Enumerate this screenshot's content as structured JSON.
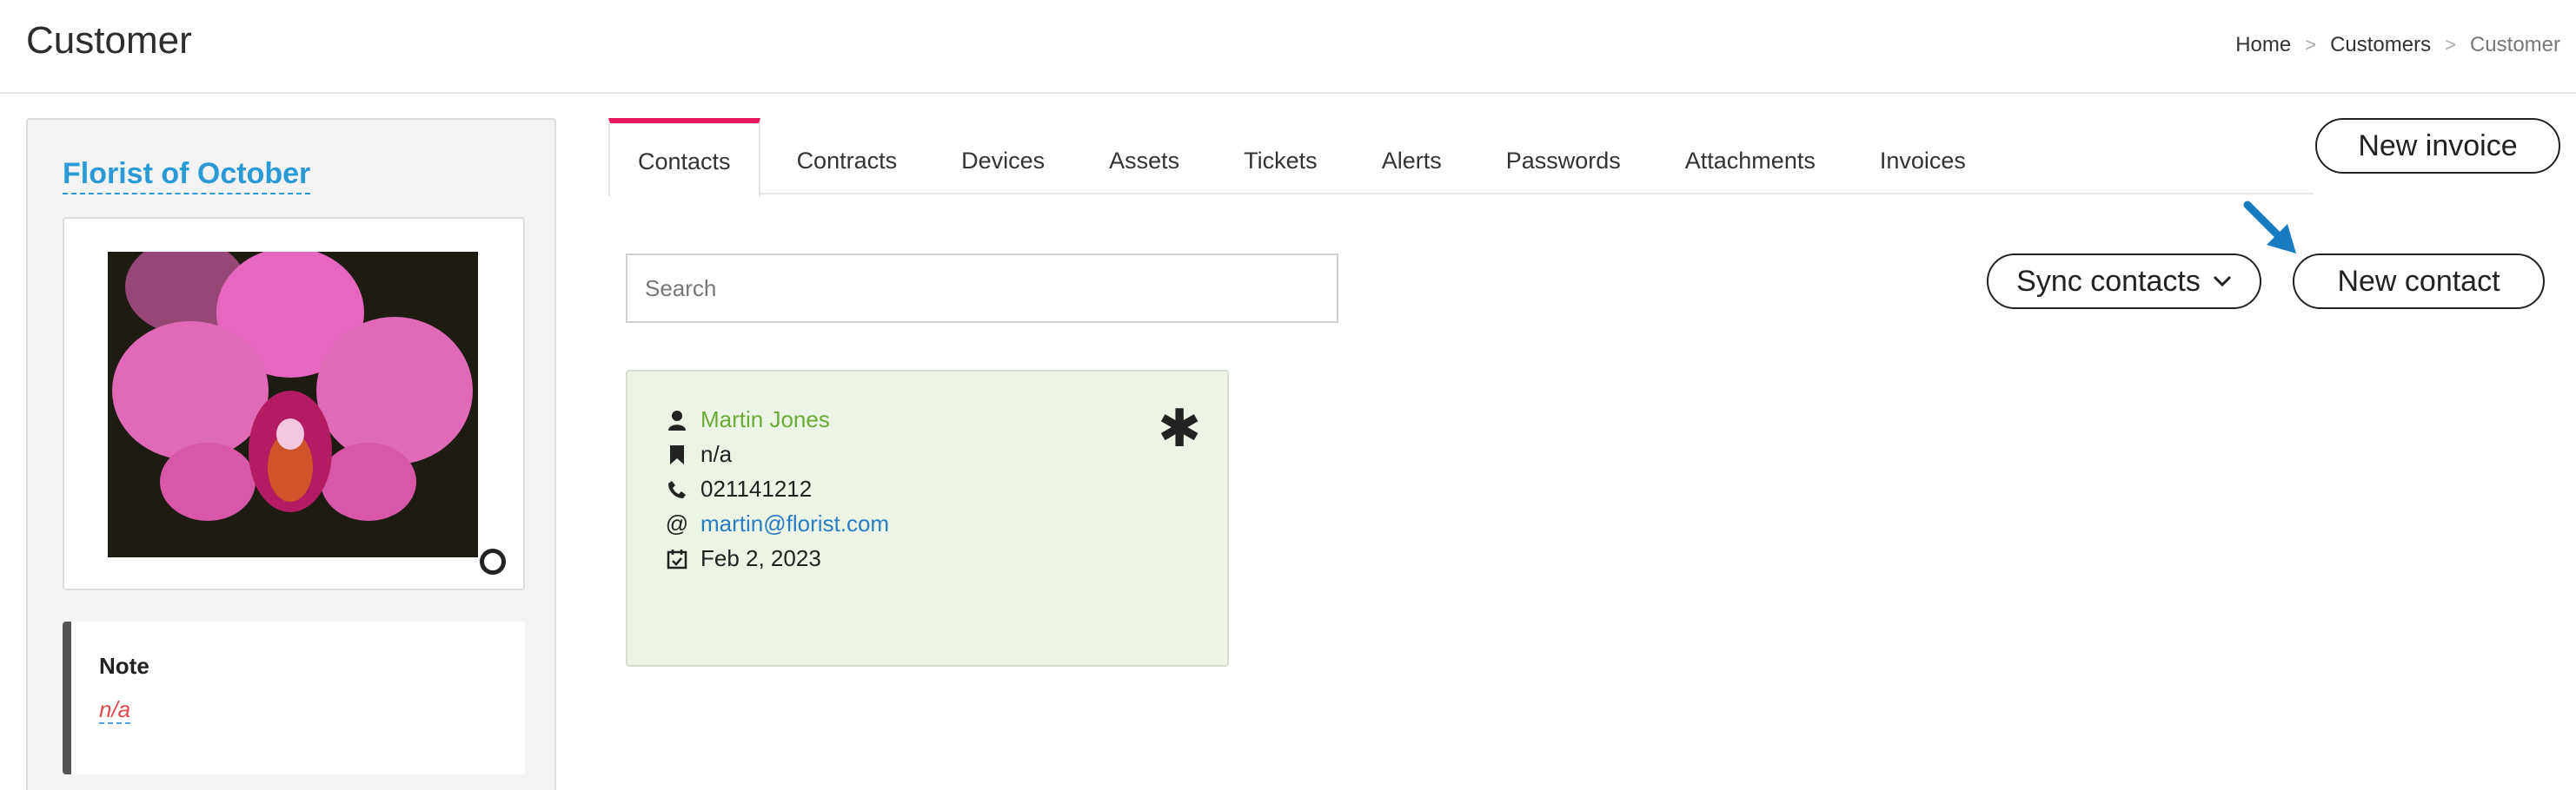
{
  "header": {
    "title": "Customer",
    "breadcrumb": [
      "Home",
      "Customers",
      "Customer"
    ],
    "separator": ">"
  },
  "customer": {
    "name": "Florist of October",
    "photo": "pink orchid flower",
    "note_title": "Note",
    "note_value": "n/a"
  },
  "tabs": [
    "Contacts",
    "Contracts",
    "Devices",
    "Assets",
    "Tickets",
    "Alerts",
    "Passwords",
    "Attachments",
    "Invoices"
  ],
  "active_tab": "Contacts",
  "actions": {
    "new_invoice": "New invoice",
    "sync_contacts": "Sync contacts",
    "new_contact": "New contact"
  },
  "search": {
    "placeholder": "Search",
    "value": ""
  },
  "contact": {
    "name": "Martin Jones",
    "title": "n/a",
    "phone": "021141212",
    "email": "martin@florist.com",
    "date": "Feb 2, 2023",
    "primary_marker": "✱"
  },
  "colors": {
    "accent_tab": "#e8175d",
    "link": "#2a9ad6",
    "contact_name": "#6aab36",
    "card_bg": "#ecf4e6",
    "arrow": "#1a7cc0"
  }
}
